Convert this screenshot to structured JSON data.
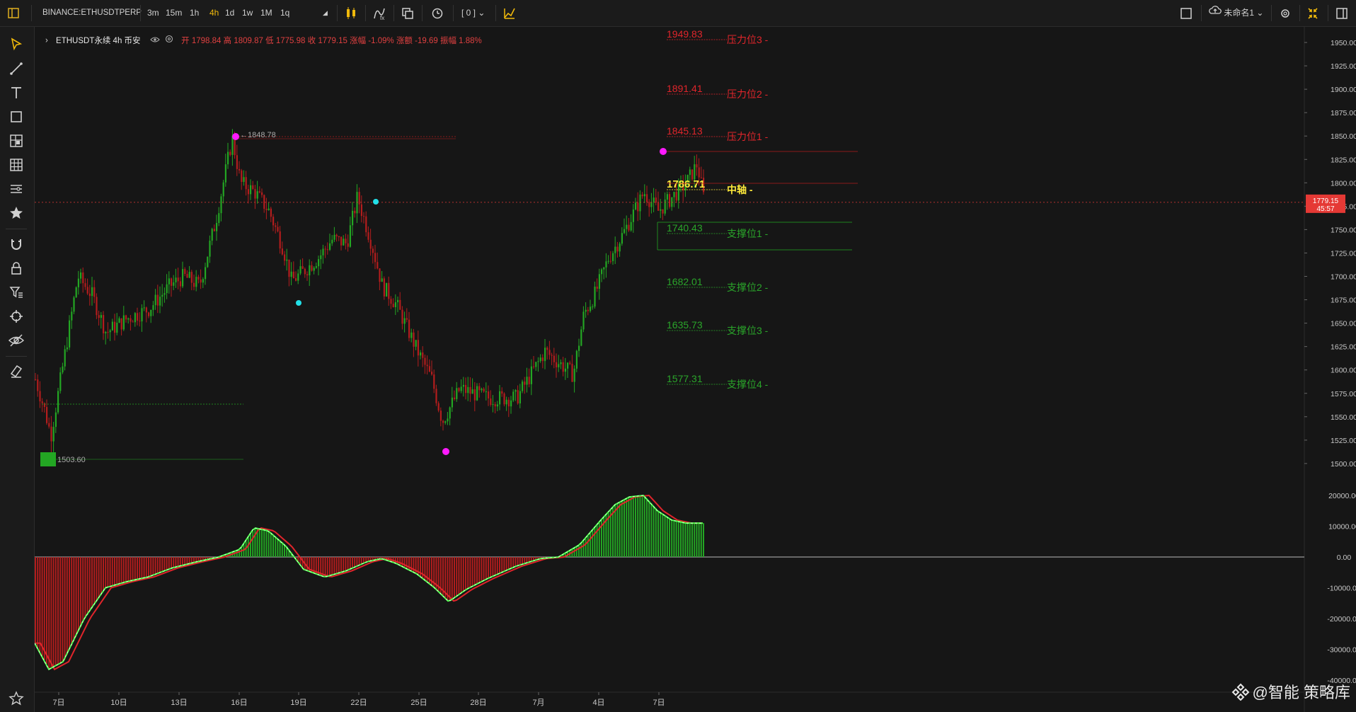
{
  "toolbar": {
    "symbol": "BINANCE:ETHUSDTPERP",
    "timeframes": [
      "3m",
      "15m",
      "1h",
      "4h",
      "1d",
      "1w",
      "1M",
      "1q"
    ],
    "active_timeframe": "4h",
    "bracket_label": "[ 0 ]",
    "layout_name": "未命名1"
  },
  "legend": {
    "title": "ETHUSDT永续 4h 币安",
    "open_label": "开",
    "open": "1798.84",
    "high_label": "高",
    "high": "1809.87",
    "low_label": "低",
    "low": "1775.98",
    "close_label": "收",
    "close": "1779.15",
    "change_label": "涨幅",
    "change": "-1.09%",
    "amount_label": "涨额",
    "amount": "-19.69",
    "amplitude_label": "振幅",
    "amplitude": "1.88%"
  },
  "price_axis": {
    "ticks": [
      "1950.00",
      "1925.00",
      "1900.00",
      "1875.00",
      "1850.00",
      "1825.00",
      "1800.00",
      "1775.00",
      "1750.00",
      "1725.00",
      "1700.00",
      "1675.00",
      "1650.00",
      "1625.00",
      "1600.00",
      "1575.00",
      "1550.00",
      "1525.00",
      "1500.00"
    ],
    "current_price": "1779.15",
    "countdown": "45:57"
  },
  "macd_axis": {
    "ticks": [
      "20000.00",
      "10000.00",
      "0.00",
      "-10000.00",
      "-20000.00",
      "-30000.00",
      "-40000.00"
    ]
  },
  "time_axis": {
    "ticks": [
      "7日",
      "10日",
      "13日",
      "16日",
      "19日",
      "22日",
      "25日",
      "28日",
      "7月",
      "4日",
      "7日"
    ]
  },
  "levels": [
    {
      "value": "1949.83",
      "label": "压力位3 -",
      "kind": "resistance",
      "price": 1949.83
    },
    {
      "value": "1891.41",
      "label": "压力位2 -",
      "kind": "resistance",
      "price": 1891.41
    },
    {
      "value": "1845.13",
      "label": "压力位1 -",
      "kind": "resistance",
      "price": 1845.13
    },
    {
      "value": "1786.71",
      "label": "中轴 -",
      "kind": "pivot",
      "price": 1786.71
    },
    {
      "value": "1740.43",
      "label": "支撑位1 -",
      "kind": "support",
      "price": 1740.43
    },
    {
      "value": "1682.01",
      "label": "支撑位2 -",
      "kind": "support",
      "price": 1682.01
    },
    {
      "value": "1635.73",
      "label": "支撑位3 -",
      "kind": "support",
      "price": 1635.73
    },
    {
      "value": "1577.31",
      "label": "支撑位4 -",
      "kind": "support",
      "price": 1577.31
    }
  ],
  "annotations": {
    "swing_high": "1848.78",
    "swing_low": "1503.60"
  },
  "colors": {
    "up": "#23a623",
    "down": "#b31d1d",
    "resistance": "#e0252b",
    "support": "#2aa52a",
    "pivot": "#ffeb3b",
    "current_price_bg": "#e53935",
    "macd_fast": "#ffffff",
    "macd_slow": "#e0252b",
    "macd_signal_up": "#4cff4c",
    "marker_magenta": "#ff1aff",
    "marker_cyan": "#22e0e8"
  },
  "watermark": "@智能 策略库"
}
